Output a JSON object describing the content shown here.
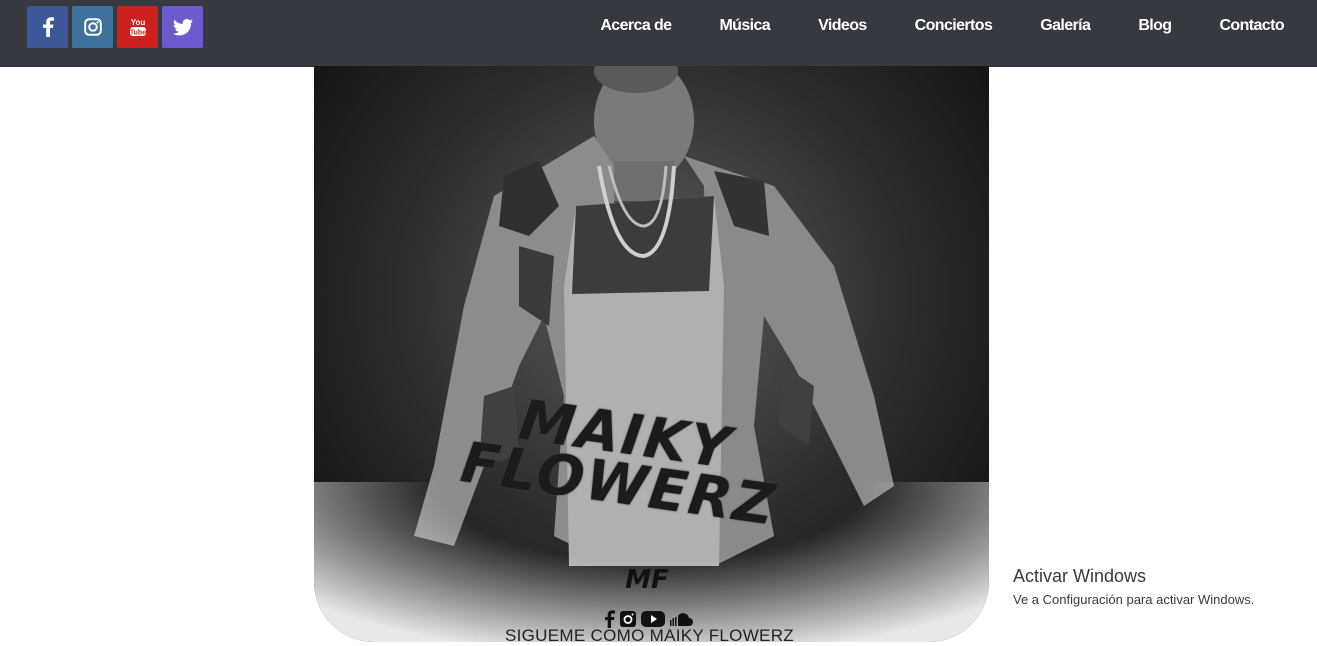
{
  "social": [
    {
      "name": "facebook",
      "icon": "facebook-icon",
      "color": "#3b5998"
    },
    {
      "name": "instagram",
      "icon": "instagram-icon",
      "color": "#3f729b"
    },
    {
      "name": "youtube",
      "icon": "youtube-icon",
      "color": "#cd201f"
    },
    {
      "name": "twitter",
      "icon": "twitter-icon",
      "color": "#6a5acd"
    }
  ],
  "nav": {
    "items": [
      {
        "label": "Acerca de"
      },
      {
        "label": "Música"
      },
      {
        "label": "Videos"
      },
      {
        "label": "Conciertos"
      },
      {
        "label": "Galería"
      },
      {
        "label": "Blog"
      },
      {
        "label": "Contacto"
      }
    ]
  },
  "hero": {
    "logo_line1": "MAIKY",
    "logo_line2": "FLOWERZ",
    "monogram": "MF",
    "follow_icons": [
      "facebook-icon",
      "instagram-icon",
      "youtube-icon",
      "soundcloud-icon"
    ],
    "follow_text": "SIGUEME COMO MAIKY FLOWERZ"
  },
  "windows": {
    "title": "Activar Windows",
    "subtitle": "Ve a Configuración para activar Windows."
  },
  "colors": {
    "header_bg": "#363940",
    "nav_text": "#ffffff"
  }
}
